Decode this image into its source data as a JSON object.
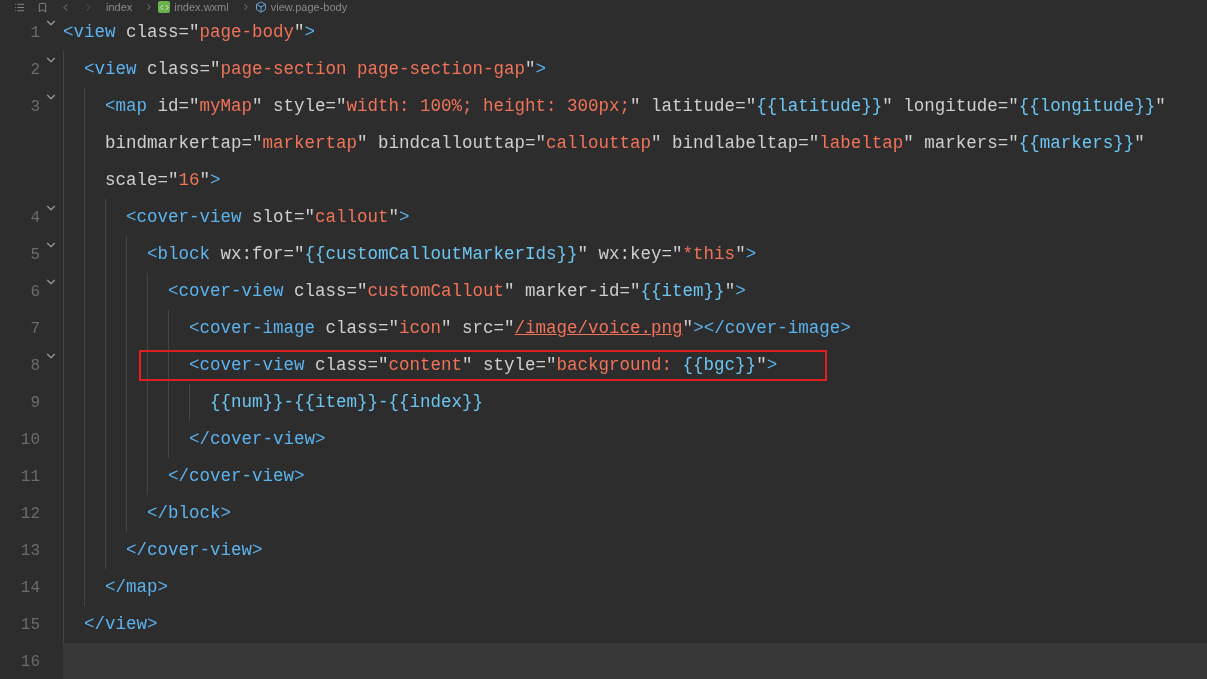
{
  "breadcrumb": {
    "items": [
      {
        "kind": "folder",
        "label": "index"
      },
      {
        "kind": "file",
        "label": "index.wxml"
      },
      {
        "kind": "element",
        "label": "view.page-body"
      }
    ]
  },
  "lines": [
    {
      "number": "1",
      "fold": true,
      "tokens": [
        {
          "kind": "tag",
          "text": "<view"
        },
        {
          "kind": "attr",
          "text": " class=\""
        },
        {
          "kind": "str",
          "text": "page-body"
        },
        {
          "kind": "attr",
          "text": "\""
        },
        {
          "kind": "tag",
          "text": ">"
        }
      ],
      "children": [
        {
          "number": "2",
          "fold": true,
          "tokens": [
            {
              "kind": "tag",
              "text": "<view"
            },
            {
              "kind": "attr",
              "text": " class=\""
            },
            {
              "kind": "str",
              "text": "page-section page-section-gap"
            },
            {
              "kind": "attr",
              "text": "\""
            },
            {
              "kind": "tag",
              "text": ">"
            }
          ],
          "children": [
            {
              "number": "3",
              "fold": true,
              "tokens": [
                {
                  "kind": "tag",
                  "text": "<map"
                },
                {
                  "kind": "attr",
                  "text": " id=\""
                },
                {
                  "kind": "str",
                  "text": "myMap"
                },
                {
                  "kind": "attr",
                  "text": "\" style=\""
                },
                {
                  "kind": "str",
                  "text": "width: 100%; height: 300px;"
                },
                {
                  "kind": "attr",
                  "text": "\" latitude=\""
                },
                {
                  "kind": "expr",
                  "text": "{{latitude}}"
                },
                {
                  "kind": "attr",
                  "text": "\" longitude=\""
                },
                {
                  "kind": "expr",
                  "text": "{{longitude}}"
                },
                {
                  "kind": "attr",
                  "text": "\""
                }
              ],
              "wrapped": [
                {
                  "tokens": [
                    {
                      "kind": "attr",
                      "text": "bindmarkertap=\""
                    },
                    {
                      "kind": "str",
                      "text": "markertap"
                    },
                    {
                      "kind": "attr",
                      "text": "\" bindcallouttap=\""
                    },
                    {
                      "kind": "str",
                      "text": "callouttap"
                    },
                    {
                      "kind": "attr",
                      "text": "\" bindlabeltap=\""
                    },
                    {
                      "kind": "str",
                      "text": "labeltap"
                    },
                    {
                      "kind": "attr",
                      "text": "\" markers=\""
                    },
                    {
                      "kind": "expr",
                      "text": "{{markers}}"
                    },
                    {
                      "kind": "attr",
                      "text": "\""
                    }
                  ]
                },
                {
                  "tokens": [
                    {
                      "kind": "attr",
                      "text": "scale=\""
                    },
                    {
                      "kind": "str",
                      "text": "16"
                    },
                    {
                      "kind": "attr",
                      "text": "\""
                    },
                    {
                      "kind": "tag",
                      "text": ">"
                    }
                  ]
                }
              ],
              "children": [
                {
                  "number": "4",
                  "fold": true,
                  "tokens": [
                    {
                      "kind": "tag",
                      "text": "<cover-view"
                    },
                    {
                      "kind": "attr",
                      "text": " slot=\""
                    },
                    {
                      "kind": "str",
                      "text": "callout"
                    },
                    {
                      "kind": "attr",
                      "text": "\""
                    },
                    {
                      "kind": "tag",
                      "text": ">"
                    }
                  ],
                  "children": [
                    {
                      "number": "5",
                      "fold": true,
                      "tokens": [
                        {
                          "kind": "tag",
                          "text": "<block"
                        },
                        {
                          "kind": "attr",
                          "text": " wx:for=\""
                        },
                        {
                          "kind": "expr",
                          "text": "{{customCalloutMarkerIds}}"
                        },
                        {
                          "kind": "attr",
                          "text": "\" wx:key=\""
                        },
                        {
                          "kind": "str",
                          "text": "*this"
                        },
                        {
                          "kind": "attr",
                          "text": "\""
                        },
                        {
                          "kind": "tag",
                          "text": ">"
                        }
                      ],
                      "children": [
                        {
                          "number": "6",
                          "fold": true,
                          "tokens": [
                            {
                              "kind": "tag",
                              "text": "<cover-view"
                            },
                            {
                              "kind": "attr",
                              "text": " class=\""
                            },
                            {
                              "kind": "str",
                              "text": "customCallout"
                            },
                            {
                              "kind": "attr",
                              "text": "\" marker-id=\""
                            },
                            {
                              "kind": "expr",
                              "text": "{{item}}"
                            },
                            {
                              "kind": "attr",
                              "text": "\""
                            },
                            {
                              "kind": "tag",
                              "text": ">"
                            }
                          ],
                          "children": [
                            {
                              "number": "7",
                              "fold": false,
                              "tokens": [
                                {
                                  "kind": "tag",
                                  "text": "<cover-image"
                                },
                                {
                                  "kind": "attr",
                                  "text": " class=\""
                                },
                                {
                                  "kind": "str",
                                  "text": "icon"
                                },
                                {
                                  "kind": "attr",
                                  "text": "\" src=\""
                                },
                                {
                                  "kind": "link",
                                  "text": "/image/voice.png"
                                },
                                {
                                  "kind": "attr",
                                  "text": "\""
                                },
                                {
                                  "kind": "tag",
                                  "text": "></cover-image>"
                                }
                              ]
                            },
                            {
                              "number": "8",
                              "fold": true,
                              "highlighted": true,
                              "tokens": [
                                {
                                  "kind": "tag",
                                  "text": "<cover-view"
                                },
                                {
                                  "kind": "attr",
                                  "text": " class=\""
                                },
                                {
                                  "kind": "str",
                                  "text": "content"
                                },
                                {
                                  "kind": "attr",
                                  "text": "\" style=\""
                                },
                                {
                                  "kind": "str",
                                  "text": "background: "
                                },
                                {
                                  "kind": "expr",
                                  "text": "{{bgc}}"
                                },
                                {
                                  "kind": "attr",
                                  "text": "\""
                                },
                                {
                                  "kind": "tag",
                                  "text": ">"
                                }
                              ],
                              "children": [
                                {
                                  "number": "9",
                                  "fold": false,
                                  "tokens": [
                                    {
                                      "kind": "expr",
                                      "text": "{{num}}-{{item}}-{{index}}"
                                    }
                                  ]
                                }
                              ]
                            },
                            {
                              "number": "10",
                              "fold": false,
                              "tokens": [
                                {
                                  "kind": "tag",
                                  "text": "</cover-view>"
                                }
                              ]
                            }
                          ]
                        },
                        {
                          "number": "11",
                          "fold": false,
                          "tokens": [
                            {
                              "kind": "tag",
                              "text": "</cover-view>"
                            }
                          ]
                        }
                      ]
                    },
                    {
                      "number": "12",
                      "fold": false,
                      "tokens": [
                        {
                          "kind": "tag",
                          "text": "</block>"
                        }
                      ]
                    }
                  ]
                },
                {
                  "number": "13",
                  "fold": false,
                  "tokens": [
                    {
                      "kind": "tag",
                      "text": "</cover-view>"
                    }
                  ]
                }
              ]
            },
            {
              "number": "14",
              "fold": false,
              "tokens": [
                {
                  "kind": "tag",
                  "text": "</map>"
                }
              ]
            }
          ]
        },
        {
          "number": "15",
          "fold": false,
          "tokens": [
            {
              "kind": "tag",
              "text": "</view>"
            }
          ]
        }
      ]
    },
    {
      "number": "16",
      "fold": false,
      "current": true
    }
  ]
}
